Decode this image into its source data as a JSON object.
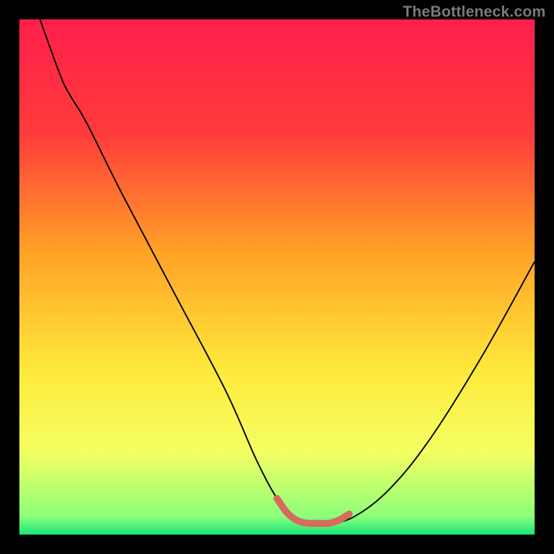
{
  "watermark": "TheBottleneck.com",
  "chart_data": {
    "type": "line",
    "title": "",
    "xlabel": "",
    "ylabel": "",
    "xlim": [
      0,
      100
    ],
    "ylim": [
      0,
      100
    ],
    "gradient_stops": [
      {
        "offset": 0.0,
        "color": "#ff1f4b"
      },
      {
        "offset": 0.22,
        "color": "#ff3b3b"
      },
      {
        "offset": 0.45,
        "color": "#ffa126"
      },
      {
        "offset": 0.68,
        "color": "#ffe93b"
      },
      {
        "offset": 0.84,
        "color": "#f4ff62"
      },
      {
        "offset": 0.965,
        "color": "#8cff7a"
      },
      {
        "offset": 1.0,
        "color": "#17e67a"
      }
    ],
    "series": [
      {
        "name": "bottleneck-curve",
        "color": "#000000",
        "width": 2,
        "x": [
          4,
          8,
          10,
          13,
          20,
          30,
          40,
          46,
          50,
          53,
          56,
          60,
          65,
          72,
          80,
          90,
          100
        ],
        "y": [
          100,
          89,
          85,
          80,
          66,
          47,
          28,
          14.5,
          7,
          3.2,
          2.2,
          2.2,
          3.5,
          9,
          19,
          35,
          53
        ]
      },
      {
        "name": "optimal-zone-marker",
        "color": "#d86a5e",
        "width": 10,
        "linecap": "round",
        "x": [
          50,
          52,
          54,
          56,
          58,
          60,
          62,
          64
        ],
        "y": [
          7,
          4.2,
          2.7,
          2.2,
          2.2,
          2.2,
          2.8,
          4.0
        ]
      }
    ]
  }
}
